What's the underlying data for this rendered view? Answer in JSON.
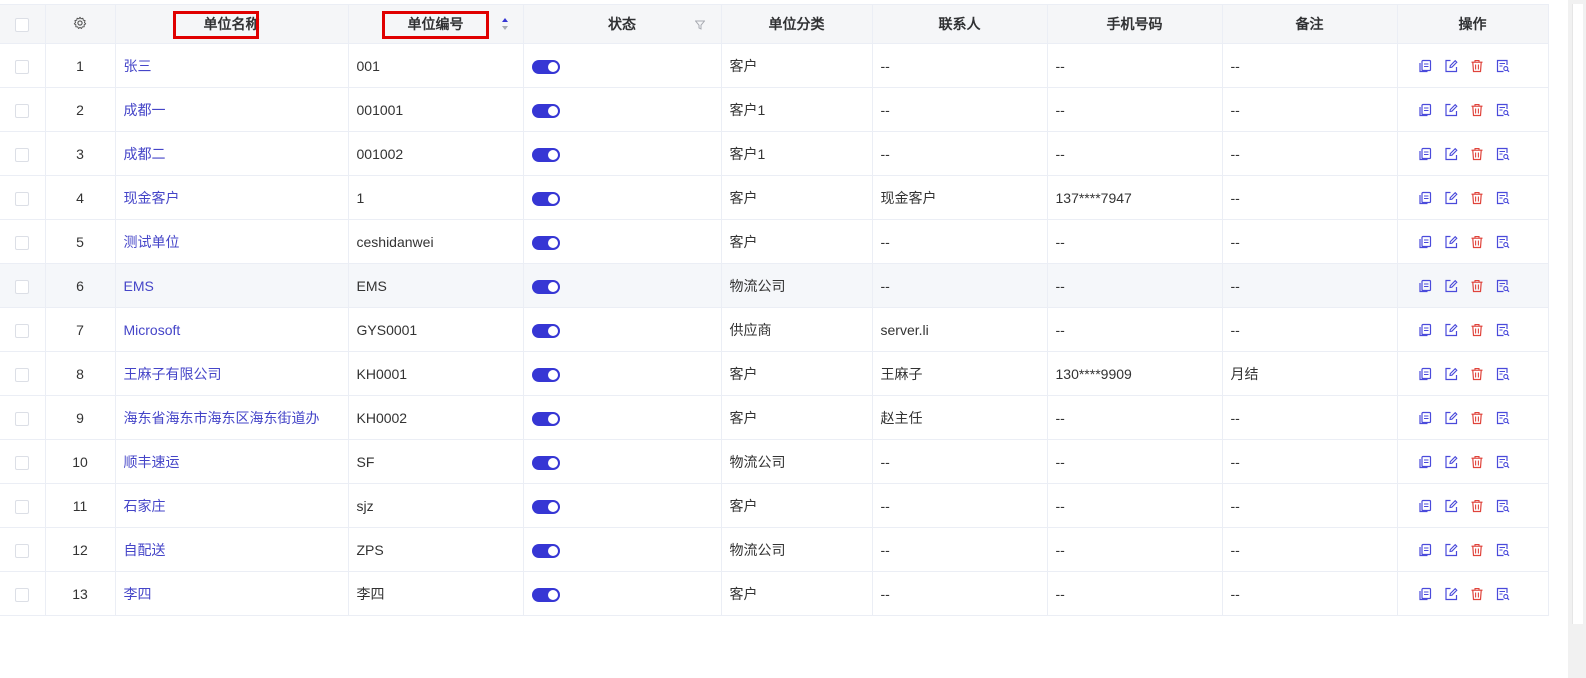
{
  "colors": {
    "link": "#4545c8",
    "toggle": "#3636d4",
    "red_box": "#e00000",
    "delete_icon": "#e0433b",
    "icon": "#4a4adb"
  },
  "columns": {
    "settings_icon": "gear-icon",
    "name": "单位名称",
    "code": "单位编号",
    "status": "状态",
    "category": "单位分类",
    "contact": "联系人",
    "phone": "手机号码",
    "remark": "备注",
    "actions": "操作"
  },
  "rows": [
    {
      "index": "1",
      "name": "张三",
      "code": "001",
      "status": true,
      "category": "客户",
      "contact": "--",
      "phone": "--",
      "remark": "--"
    },
    {
      "index": "2",
      "name": "成都一",
      "code": "001001",
      "status": true,
      "category": "客户1",
      "contact": "--",
      "phone": "--",
      "remark": "--"
    },
    {
      "index": "3",
      "name": "成都二",
      "code": "001002",
      "status": true,
      "category": "客户1",
      "contact": "--",
      "phone": "--",
      "remark": "--"
    },
    {
      "index": "4",
      "name": "现金客户",
      "code": "1",
      "status": true,
      "category": "客户",
      "contact": "现金客户",
      "phone": "137****7947",
      "remark": "--"
    },
    {
      "index": "5",
      "name": "测试单位",
      "code": "ceshidanwei",
      "status": true,
      "category": "客户",
      "contact": "--",
      "phone": "--",
      "remark": "--"
    },
    {
      "index": "6",
      "name": "EMS",
      "code": "EMS",
      "status": true,
      "category": "物流公司",
      "contact": "--",
      "phone": "--",
      "remark": "--"
    },
    {
      "index": "7",
      "name": "Microsoft",
      "code": "GYS0001",
      "status": true,
      "category": "供应商",
      "contact": "server.li",
      "phone": "--",
      "remark": "--"
    },
    {
      "index": "8",
      "name": "王麻子有限公司",
      "code": "KH0001",
      "status": true,
      "category": "客户",
      "contact": "王麻子",
      "phone": "130****9909",
      "remark": "月结"
    },
    {
      "index": "9",
      "name": "海东省海东市海东区海东街道办",
      "code": "KH0002",
      "status": true,
      "category": "客户",
      "contact": "赵主任",
      "phone": "--",
      "remark": "--"
    },
    {
      "index": "10",
      "name": "顺丰速运",
      "code": "SF",
      "status": true,
      "category": "物流公司",
      "contact": "--",
      "phone": "--",
      "remark": "--"
    },
    {
      "index": "11",
      "name": "石家庄",
      "code": "sjz",
      "status": true,
      "category": "客户",
      "contact": "--",
      "phone": "--",
      "remark": "--"
    },
    {
      "index": "12",
      "name": "自配送",
      "code": "ZPS",
      "status": true,
      "category": "物流公司",
      "contact": "--",
      "phone": "--",
      "remark": "--"
    },
    {
      "index": "13",
      "name": "李四",
      "code": "李四",
      "status": true,
      "category": "客户",
      "contact": "--",
      "phone": "--",
      "remark": "--"
    }
  ],
  "highlighted_row": 6,
  "row_actions": [
    "copy-icon",
    "edit-icon",
    "delete-icon",
    "detail-icon"
  ]
}
